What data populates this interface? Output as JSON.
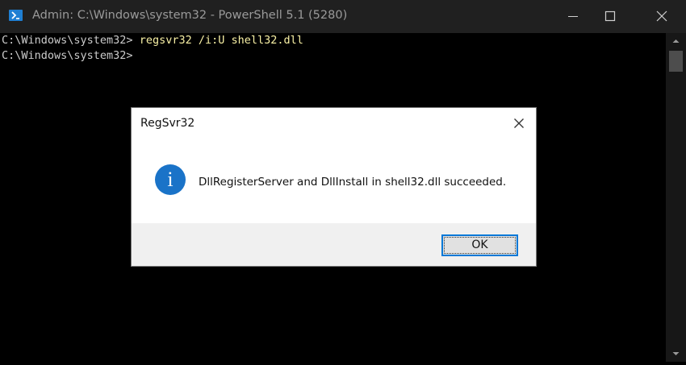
{
  "window": {
    "title": "Admin: C:\\Windows\\system32 - PowerShell 5.1 (5280)",
    "icon": "powershell-icon",
    "controls": [
      "minimize-icon",
      "maximize-icon",
      "close-icon"
    ]
  },
  "console": {
    "line1_prompt": "C:\\Windows\\system32> ",
    "line1_command": "regsvr32 /i:U shell32.dll",
    "line2_prompt": "C:\\Windows\\system32>"
  },
  "dialog": {
    "title": "RegSvr32",
    "icon": "info-icon",
    "icon_glyph": "i",
    "message": "DllRegisterServer and DllInstall in shell32.dll succeeded.",
    "ok_label": "OK"
  },
  "colors": {
    "console_bg": "#000000",
    "console_text": "#cccccc",
    "command_text": "#f9f1a5",
    "titlebar_bg": "#202020",
    "accent": "#0078d7",
    "info_icon": "#1a73c8"
  }
}
